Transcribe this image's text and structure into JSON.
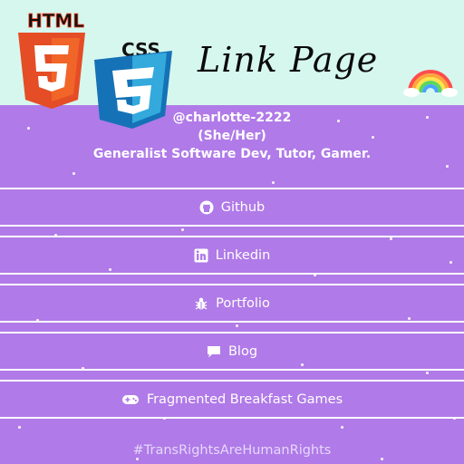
{
  "header": {
    "title": "Link Page",
    "html_logo_text": "HTML",
    "css_logo_text": "CSS"
  },
  "profile": {
    "handle": "@charlotte-2222",
    "pronouns": "(She/Her)",
    "bio": "Generalist Software Dev, Tutor, Gamer."
  },
  "links": [
    {
      "label": "Github",
      "icon": "github-icon"
    },
    {
      "label": "Linkedin",
      "icon": "linkedin-icon"
    },
    {
      "label": "Portfolio",
      "icon": "bug-icon"
    },
    {
      "label": "Blog",
      "icon": "chat-bubble-icon"
    },
    {
      "label": "Fragmented Breakfast Games",
      "icon": "gamepad-icon"
    }
  ],
  "footer": {
    "hashtag": "#TransRightsAreHumanRights"
  },
  "colors": {
    "background": "#b07ae8",
    "header": "#d6f7ee",
    "text": "#ffffff",
    "html_orange": "#e44d26",
    "css_blue": "#1572b6"
  }
}
